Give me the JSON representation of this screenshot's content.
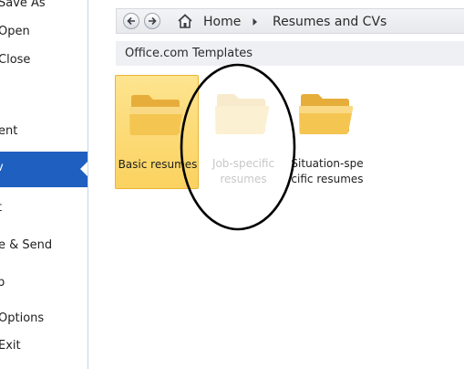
{
  "sidebar": {
    "items": [
      {
        "label": "Save As"
      },
      {
        "label": "Open"
      },
      {
        "label": "Close"
      },
      {
        "label": "ent"
      },
      {
        "label": "v"
      },
      {
        "label": "t"
      },
      {
        "label": "e & Send"
      },
      {
        "label": "p"
      },
      {
        "label": "Options"
      },
      {
        "label": "Exit"
      }
    ]
  },
  "breadcrumb": {
    "home_label": "Home",
    "current_label": "Resumes and CVs"
  },
  "section": {
    "title": "Office.com Templates"
  },
  "tiles": [
    {
      "line1": "Basic resumes",
      "line2": ""
    },
    {
      "line1": "Job-specific",
      "line2": "resumes"
    },
    {
      "line1": "Situation-spe",
      "line2": "cific resumes"
    }
  ],
  "colors": {
    "selected_menu": "#1f5fbf",
    "selected_tile": "#fbd260",
    "folder": "#f2c14e"
  }
}
